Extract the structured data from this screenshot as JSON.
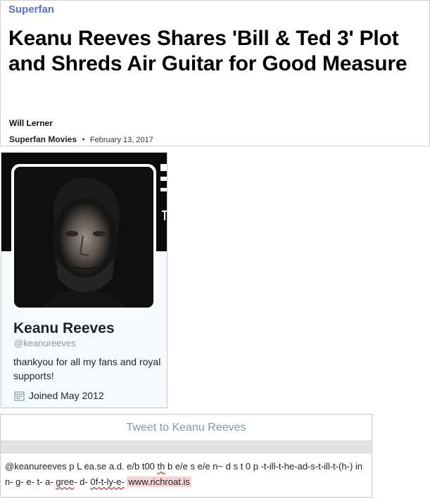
{
  "article": {
    "section": "Superfan",
    "headline": "Keanu Reeves Shares 'Bill & Ted 3' Plot and Shreds Air Guitar for Good Measure",
    "author": "Will Lerner",
    "source": "Superfan Movies",
    "separator": "•",
    "date": "February 13, 2017"
  },
  "profile": {
    "name": "Keanu Reeves",
    "handle": "@keanureeves",
    "bio": "thankyou for all my fans and royal supports!",
    "joined": "Joined May 2012",
    "avatar_icon": "portrait-photo",
    "calendar_icon": "calendar-icon"
  },
  "tweet": {
    "header": "Tweet to Keanu Reeves",
    "text_parts": [
      "@keanureeves p L ea.se a.d. e/b t00 ",
      "th",
      " b e/e s e/e n~ d s t 0 p -t-ill-t-he-ad-s-t-ill-t-(h-) inn- g- e- t- a- ",
      "gree",
      "- d- ",
      "0f-t-ly-e-",
      " "
    ],
    "link": "www.richroat.is"
  },
  "colors": {
    "brand": "#5b6ee1",
    "muted": "#8a96a3",
    "link_highlight": "#f7d4d7"
  }
}
